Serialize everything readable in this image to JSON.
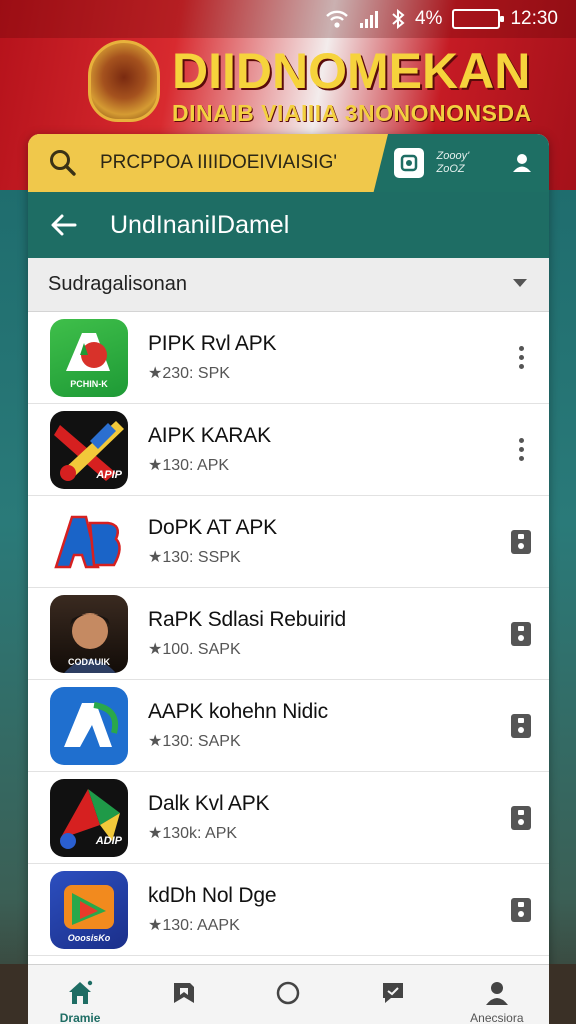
{
  "status_bar": {
    "battery_text": "4%",
    "time": "12:30"
  },
  "banner": {
    "title": "DIIDNOMEKAN",
    "subtitle": "DINAIB VIAIIIA 3NONONONSDA"
  },
  "search": {
    "placeholder": "PRCPPOA IIIIDOEIVIAISIG'",
    "aux_text": "Zoooy' ZoOZ"
  },
  "toolbar": {
    "title": "UndInaniIDamel"
  },
  "filter": {
    "label": "Sudragalisonan"
  },
  "apps": [
    {
      "name": "PIPK Rvl APK",
      "meta": "★230: SPK",
      "icon_text": "PCHIN-K",
      "action": "more"
    },
    {
      "name": "AIPK KARAK",
      "meta": "★130: APK",
      "icon_text": "APIP",
      "action": "more"
    },
    {
      "name": "DoPK AT APK",
      "meta": "★130: SSPK",
      "icon_text": "AB",
      "action": "download"
    },
    {
      "name": "RaPK Sdlasi Rebuirid",
      "meta": "★100. SAPK",
      "icon_text": "CODAUIK",
      "action": "download"
    },
    {
      "name": "AAPK kohehn Nidic",
      "meta": "★130: SAPK",
      "icon_text": "A",
      "action": "download"
    },
    {
      "name": "Dalk Kvl APK",
      "meta": "★130k: APK",
      "icon_text": "ADIP",
      "action": "download"
    },
    {
      "name": "kdDh Nol Dge",
      "meta": "★130: AAPK",
      "icon_text": "OoosisKo",
      "action": "download"
    }
  ],
  "bottom_nav": [
    {
      "label": "Dramie",
      "icon": "home-icon",
      "active": true
    },
    {
      "label": "",
      "icon": "bookmark-icon",
      "active": false
    },
    {
      "label": "",
      "icon": "circle-icon",
      "active": false
    },
    {
      "label": "",
      "icon": "chat-icon",
      "active": false
    },
    {
      "label": "Anecsiora",
      "icon": "profile-icon",
      "active": false
    }
  ],
  "colors": {
    "accent": "#1e6d64",
    "search_yellow": "#f0c84b",
    "banner_red": "#c51b24"
  }
}
